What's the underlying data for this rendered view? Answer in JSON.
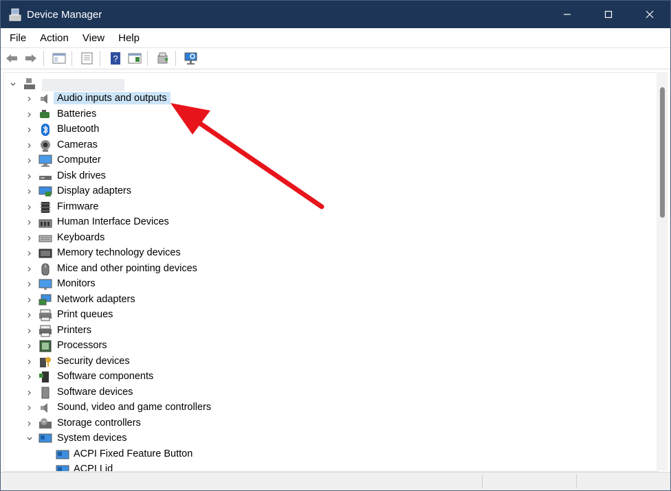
{
  "window": {
    "title": "Device Manager"
  },
  "menu": [
    {
      "label": "File"
    },
    {
      "label": "Action"
    },
    {
      "label": "View"
    },
    {
      "label": "Help"
    }
  ],
  "toolbar": {
    "buttons": [
      "back-arrow-icon",
      "forward-arrow-icon",
      "console-tree-icon",
      "properties-icon",
      "help-icon",
      "details-view-icon",
      "update-driver-icon",
      "scan-hardware-icon"
    ]
  },
  "tree": {
    "root_label": "",
    "categories": [
      {
        "label": "Audio inputs and outputs",
        "icon": "speaker-icon",
        "selected": true
      },
      {
        "label": "Batteries",
        "icon": "battery-icon"
      },
      {
        "label": "Bluetooth",
        "icon": "bluetooth-icon"
      },
      {
        "label": "Cameras",
        "icon": "camera-icon"
      },
      {
        "label": "Computer",
        "icon": "computer-icon"
      },
      {
        "label": "Disk drives",
        "icon": "disk-drive-icon"
      },
      {
        "label": "Display adapters",
        "icon": "display-adapter-icon"
      },
      {
        "label": "Firmware",
        "icon": "firmware-icon"
      },
      {
        "label": "Human Interface Devices",
        "icon": "hid-icon"
      },
      {
        "label": "Keyboards",
        "icon": "keyboard-icon"
      },
      {
        "label": "Memory technology devices",
        "icon": "memory-icon"
      },
      {
        "label": "Mice and other pointing devices",
        "icon": "mouse-icon"
      },
      {
        "label": "Monitors",
        "icon": "monitor-icon"
      },
      {
        "label": "Network adapters",
        "icon": "network-icon"
      },
      {
        "label": "Print queues",
        "icon": "print-queue-icon"
      },
      {
        "label": "Printers",
        "icon": "printer-icon"
      },
      {
        "label": "Processors",
        "icon": "processor-icon"
      },
      {
        "label": "Security devices",
        "icon": "security-icon"
      },
      {
        "label": "Software components",
        "icon": "software-component-icon"
      },
      {
        "label": "Software devices",
        "icon": "software-device-icon"
      },
      {
        "label": "Sound, video and game controllers",
        "icon": "speaker-icon"
      },
      {
        "label": "Storage controllers",
        "icon": "storage-icon"
      },
      {
        "label": "System devices",
        "icon": "system-devices-icon",
        "expanded": true
      }
    ],
    "children": [
      {
        "label": "ACPI Fixed Feature Button",
        "icon": "system-device-icon"
      },
      {
        "label": "ACPI Lid",
        "icon": "system-device-icon"
      }
    ]
  },
  "colors": {
    "titlebar": "#1d3557",
    "selection": "#cce4f7",
    "annotation_arrow": "#e8141b"
  }
}
